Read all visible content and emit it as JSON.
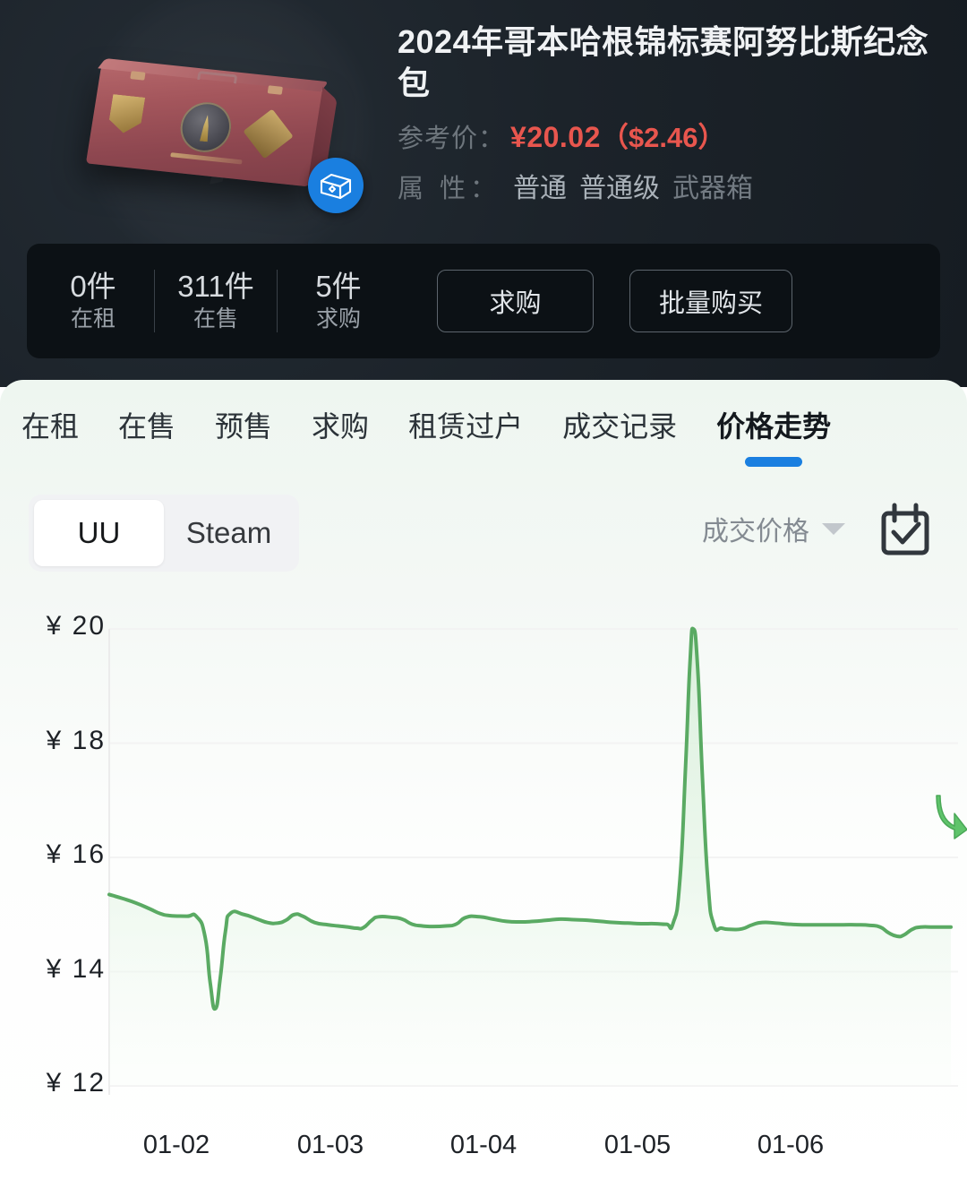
{
  "header": {
    "product_image_alt": "csgo-weapon-case",
    "badge_icon": "box-icon",
    "title": "2024年哥本哈根锦标赛阿努比斯纪念包",
    "price_label": "参考价：",
    "price_cny": "¥20.02",
    "price_usd": "（$2.46）",
    "price_color": "#e8564e",
    "attr_label": "属 性：",
    "attrs": [
      "普通",
      "普通级",
      "武器箱"
    ]
  },
  "stats": {
    "items": [
      {
        "count": "0件",
        "label": "在租"
      },
      {
        "count": "311件",
        "label": "在售"
      },
      {
        "count": "5件",
        "label": "求购"
      }
    ],
    "buttons": [
      {
        "label": "求购"
      },
      {
        "label": "批量购买"
      }
    ]
  },
  "tabs": {
    "items": [
      {
        "label": "在租",
        "active": false
      },
      {
        "label": "在售",
        "active": false
      },
      {
        "label": "预售",
        "active": false
      },
      {
        "label": "求购",
        "active": false
      },
      {
        "label": "租赁过户",
        "active": false
      },
      {
        "label": "成交记录",
        "active": false
      },
      {
        "label": "价格走势",
        "active": true
      }
    ],
    "active_indicator_color": "#1a7fe0",
    "cursor_icon": "cursor-arrow-green"
  },
  "controls": {
    "source_toggle": {
      "options": [
        "UU",
        "Steam"
      ],
      "selected": "UU"
    },
    "metric_dropdown": {
      "label": "成交价格",
      "icon": "chevron-down-icon"
    },
    "calendar_button": {
      "icon": "calendar-check-icon"
    }
  },
  "chart_data": {
    "type": "area",
    "title": "",
    "xlabel": "",
    "ylabel": "",
    "line_color": "#5aaa63",
    "fill_color": "#e3f3e4",
    "grid": true,
    "ylim": [
      12,
      20
    ],
    "ytick_labels": [
      "¥ 20",
      "¥ 18",
      "¥ 16",
      "¥ 14",
      "¥ 12"
    ],
    "ytick_values": [
      20,
      18,
      16,
      14,
      12
    ],
    "xtick_labels": [
      "01-02",
      "01-03",
      "01-04",
      "01-05",
      "01-06"
    ],
    "series": [
      {
        "name": "成交价格",
        "points": [
          {
            "x": 0.0,
            "y": 15.35
          },
          {
            "x": 0.04,
            "y": 15.28
          },
          {
            "x": 0.08,
            "y": 15.2
          },
          {
            "x": 0.12,
            "y": 15.1
          },
          {
            "x": 0.15,
            "y": 15.02
          },
          {
            "x": 0.18,
            "y": 14.98
          },
          {
            "x": 0.23,
            "y": 14.97
          },
          {
            "x": 0.26,
            "y": 14.96
          },
          {
            "x": 0.285,
            "y": 14.6
          },
          {
            "x": 0.3,
            "y": 13.8
          },
          {
            "x": 0.315,
            "y": 13.35
          },
          {
            "x": 0.33,
            "y": 13.9
          },
          {
            "x": 0.345,
            "y": 14.7
          },
          {
            "x": 0.36,
            "y": 15.02
          },
          {
            "x": 0.4,
            "y": 15.0
          },
          {
            "x": 0.44,
            "y": 14.92
          },
          {
            "x": 0.47,
            "y": 14.86
          },
          {
            "x": 0.5,
            "y": 14.85
          },
          {
            "x": 0.525,
            "y": 14.9
          },
          {
            "x": 0.55,
            "y": 15.0
          },
          {
            "x": 0.575,
            "y": 14.97
          },
          {
            "x": 0.61,
            "y": 14.86
          },
          {
            "x": 0.65,
            "y": 14.82
          },
          {
            "x": 0.68,
            "y": 14.8
          },
          {
            "x": 0.71,
            "y": 14.78
          },
          {
            "x": 0.735,
            "y": 14.76
          },
          {
            "x": 0.755,
            "y": 14.77
          },
          {
            "x": 0.78,
            "y": 14.9
          },
          {
            "x": 0.8,
            "y": 14.96
          },
          {
            "x": 0.84,
            "y": 14.95
          },
          {
            "x": 0.87,
            "y": 14.92
          },
          {
            "x": 0.9,
            "y": 14.83
          },
          {
            "x": 0.93,
            "y": 14.8
          },
          {
            "x": 0.96,
            "y": 14.79
          },
          {
            "x": 1.0,
            "y": 14.8
          },
          {
            "x": 1.03,
            "y": 14.83
          },
          {
            "x": 1.06,
            "y": 14.95
          },
          {
            "x": 1.1,
            "y": 14.96
          },
          {
            "x": 1.14,
            "y": 14.92
          },
          {
            "x": 1.18,
            "y": 14.88
          },
          {
            "x": 1.22,
            "y": 14.87
          },
          {
            "x": 1.26,
            "y": 14.88
          },
          {
            "x": 1.3,
            "y": 14.9
          },
          {
            "x": 1.34,
            "y": 14.92
          },
          {
            "x": 1.38,
            "y": 14.91
          },
          {
            "x": 1.42,
            "y": 14.9
          },
          {
            "x": 1.46,
            "y": 14.88
          },
          {
            "x": 1.5,
            "y": 14.86
          },
          {
            "x": 1.54,
            "y": 14.85
          },
          {
            "x": 1.58,
            "y": 14.84
          },
          {
            "x": 1.62,
            "y": 14.84
          },
          {
            "x": 1.655,
            "y": 14.83
          },
          {
            "x": 1.675,
            "y": 14.85
          },
          {
            "x": 1.695,
            "y": 15.6
          },
          {
            "x": 1.712,
            "y": 17.6
          },
          {
            "x": 1.725,
            "y": 19.4
          },
          {
            "x": 1.735,
            "y": 20.0
          },
          {
            "x": 1.748,
            "y": 19.3
          },
          {
            "x": 1.762,
            "y": 17.4
          },
          {
            "x": 1.778,
            "y": 15.6
          },
          {
            "x": 1.795,
            "y": 14.84
          },
          {
            "x": 1.82,
            "y": 14.76
          },
          {
            "x": 1.85,
            "y": 14.74
          },
          {
            "x": 1.88,
            "y": 14.75
          },
          {
            "x": 1.91,
            "y": 14.82
          },
          {
            "x": 1.94,
            "y": 14.86
          },
          {
            "x": 1.98,
            "y": 14.85
          },
          {
            "x": 2.02,
            "y": 14.83
          },
          {
            "x": 2.06,
            "y": 14.82
          },
          {
            "x": 2.1,
            "y": 14.82
          },
          {
            "x": 2.14,
            "y": 14.82
          },
          {
            "x": 2.18,
            "y": 14.82
          },
          {
            "x": 2.22,
            "y": 14.82
          },
          {
            "x": 2.26,
            "y": 14.81
          },
          {
            "x": 2.29,
            "y": 14.78
          },
          {
            "x": 2.315,
            "y": 14.68
          },
          {
            "x": 2.34,
            "y": 14.62
          },
          {
            "x": 2.36,
            "y": 14.64
          },
          {
            "x": 2.385,
            "y": 14.74
          },
          {
            "x": 2.41,
            "y": 14.78
          },
          {
            "x": 2.45,
            "y": 14.78
          },
          {
            "x": 2.5,
            "y": 14.78
          }
        ]
      }
    ]
  }
}
